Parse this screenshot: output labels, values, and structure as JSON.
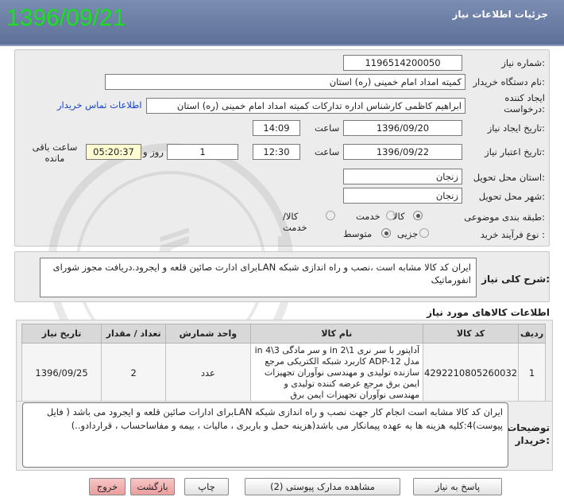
{
  "header": {
    "title": "جزئیات اطلاعات نیاز",
    "date_stamp": "1396/09/21"
  },
  "form": {
    "need_number_label": "شماره نیاز:",
    "need_number": "1196514200050",
    "buyer_label": "نام دستگاه خریدار:",
    "buyer": "کمیته امداد امام خمینی (ره) استان",
    "creator_label": "ایجاد کننده درخواست:",
    "creator": "ابراهیم  کاظمی  کارشناس اداره تدارکات   کمیته امداد امام خمینی (ره) استان",
    "contact_link": "اطلاعات تماس خریدار",
    "created_date_label": "تاریخ ایجاد نیاز:",
    "created_date": "1396/09/20",
    "created_time_label": "ساعت",
    "created_time": "14:09",
    "validity_label": "تاریخ اعتبار نیاز:",
    "validity_date": "1396/09/22",
    "validity_time_label": "ساعت",
    "validity_time": "12:30",
    "days_value": "1",
    "days_label": "روز و",
    "remaining_time": "05:20:37",
    "remaining_label": "ساعت باقی مانده",
    "province_label": "استان محل تحویل:",
    "province": "زنجان",
    "city_label": "شهر محل تحویل:",
    "city": "زنجان",
    "category_label": "طبقه بندی موضوعی:",
    "category_options": [
      "کالا",
      "خدمت",
      "کالا/خدمت"
    ],
    "category_selected": "کالا",
    "process_label": "نوع فرآیند خرید :",
    "process_options": [
      "جزیی",
      "متوسط"
    ],
    "process_selected": "متوسط"
  },
  "summary": {
    "label": "شرح کلی نیاز:",
    "text": "ایران کد کالا مشابه است ،نصب و راه اندازی شبکه LANبرای ادارت  صائین قلعه و ایجرود.دریافت مجوز شورای انفورماتیک"
  },
  "items_section": {
    "title": "اطلاعات کالاهای مورد نیاز",
    "columns": [
      "ردیف",
      "کد کالا",
      "نام کالا",
      "واحد شمارش",
      "تعداد / مقدار",
      "تاریخ نیاز"
    ],
    "rows": [
      {
        "index": "1",
        "code": "4292210805260032",
        "name": "آداپتور با سر نری 1\\2 in و سر مادگی 3\\4 in مدل ADP-12 کاربرد شبکه الکتریکی مرجع سازنده تولیدی و مهندسی نوآوران تجهیزات ایمن برق مرجع عرضه کننده تولیدی و مهندسی نوآوران تجهیزات ایمن برق",
        "unit": "عدد",
        "qty": "2",
        "date": "1396/09/25"
      }
    ]
  },
  "notes": {
    "label": "توضیحات خریدار:",
    "text": "ایران کد کالا مشابه است انجام کار جهت  نصب و راه اندازی شبکه LANبرای ادارات صائین قلعه و ایجرود می باشد ( فایل پیوست)4:کلیه هزینه ها به عهده پیمانکار می باشد(هزینه  حمل و باربری ، مالیات ، بیمه و مفاساحساب ، قراردادو..)"
  },
  "buttons": {
    "reply": "پاسخ به نیاز",
    "attachments": "مشاهده مدارک پیوستی (2)",
    "print": "چاپ",
    "back": "بازگشت",
    "exit": "خروج"
  },
  "watermark": "هزاره گستران"
}
